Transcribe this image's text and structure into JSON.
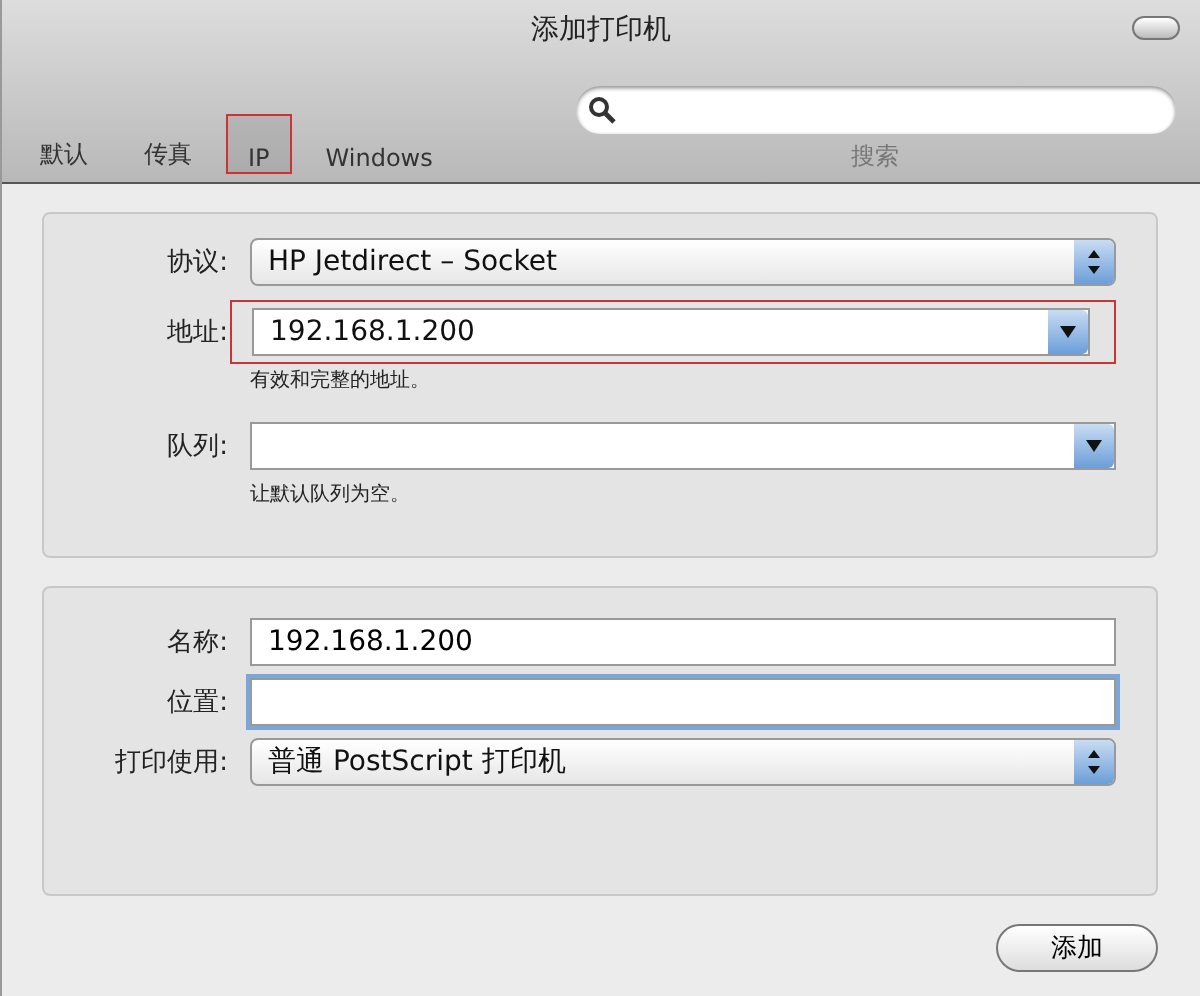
{
  "window": {
    "title": "添加打印机"
  },
  "toolbar": {
    "items": [
      {
        "label": "默认",
        "selected": false,
        "highlighted": false
      },
      {
        "label": "传真",
        "selected": false,
        "highlighted": false
      },
      {
        "label": "IP",
        "selected": true,
        "highlighted": true
      },
      {
        "label": "Windows",
        "selected": false,
        "highlighted": false
      }
    ],
    "search": {
      "label": "搜索"
    }
  },
  "connection_panel": {
    "rows": [
      {
        "label": "协议:",
        "kind": "popup",
        "value": "HP Jetdirect – Socket",
        "highlighted": false
      },
      {
        "label": "地址:",
        "kind": "combo",
        "value": "192.168.1.200",
        "hint": "有效和完整的地址。",
        "highlighted": true
      },
      {
        "label": "队列:",
        "kind": "combo",
        "value": "",
        "hint": "让默认队列为空。",
        "highlighted": false
      }
    ]
  },
  "printer_panel": {
    "rows": [
      {
        "label": "名称:",
        "kind": "text",
        "value": "192.168.1.200",
        "focused": false
      },
      {
        "label": "位置:",
        "kind": "text",
        "value": "",
        "focused": true
      },
      {
        "label": "打印使用:",
        "kind": "popup",
        "value": "普通 PostScript 打印机",
        "focused": false
      }
    ]
  },
  "buttons": [
    {
      "label": "添加"
    }
  ]
}
